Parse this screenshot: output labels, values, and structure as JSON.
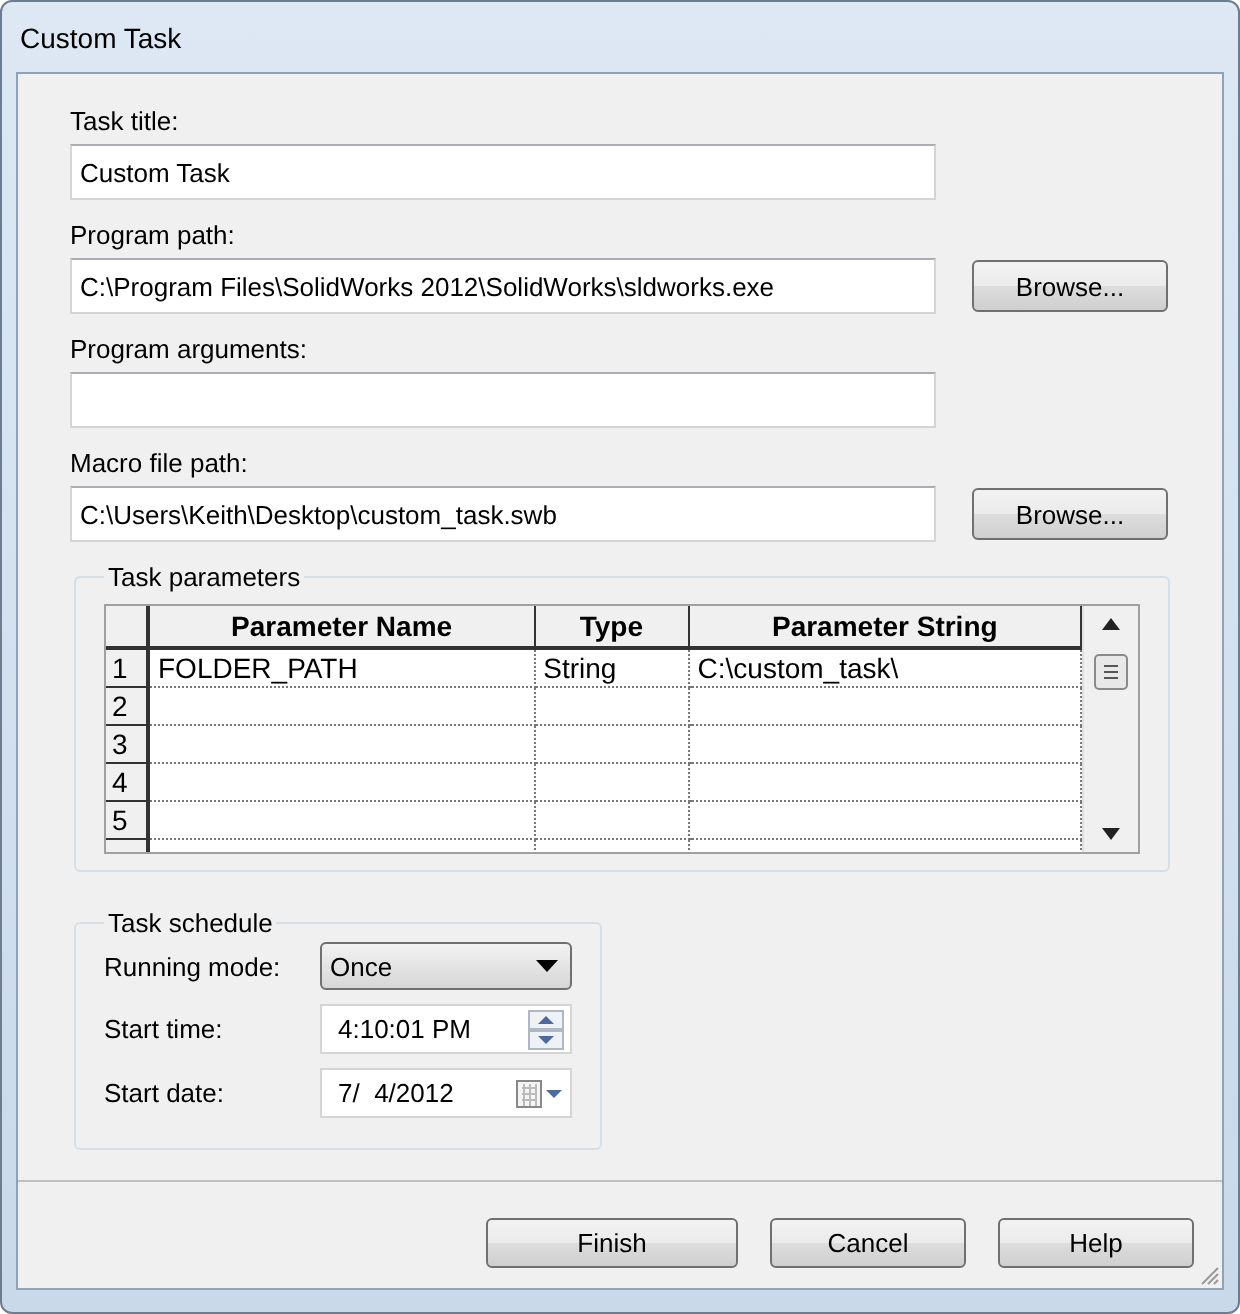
{
  "window": {
    "title": "Custom Task"
  },
  "fields": [
    {
      "label": "Task title:",
      "value": "Custom Task"
    },
    {
      "label": "Program path:",
      "value": "C:\\Program Files\\SolidWorks 2012\\SolidWorks\\sldworks.exe",
      "button": "Browse..."
    },
    {
      "label": "Program arguments:"
    },
    {
      "label": "Macro file path:",
      "value": "C:\\Users\\Keith\\Desktop\\custom_task.swb",
      "button": "Browse..."
    }
  ],
  "task_parameters": {
    "title": "Task parameters",
    "columns": [
      "Parameter Name",
      "Type",
      "Parameter String"
    ],
    "rows": [
      {
        "number": "1",
        "cells": [
          "FOLDER_PATH",
          "String",
          "C:\\custom_task\\"
        ]
      },
      {
        "number": "2",
        "cells": []
      },
      {
        "number": "3",
        "cells": []
      },
      {
        "number": "4",
        "cells": []
      },
      {
        "number": "5",
        "cells": []
      }
    ]
  },
  "task_schedule": {
    "title": "Task schedule",
    "running_mode": {
      "label": "Running mode:",
      "value": "Once"
    },
    "start_time": {
      "label": "Start time:",
      "value": "4:10:01 PM"
    },
    "start_date": {
      "label": "Start date:",
      "value": "7/  4/2012"
    }
  },
  "buttons": [
    "Finish",
    "Cancel",
    "Help"
  ]
}
